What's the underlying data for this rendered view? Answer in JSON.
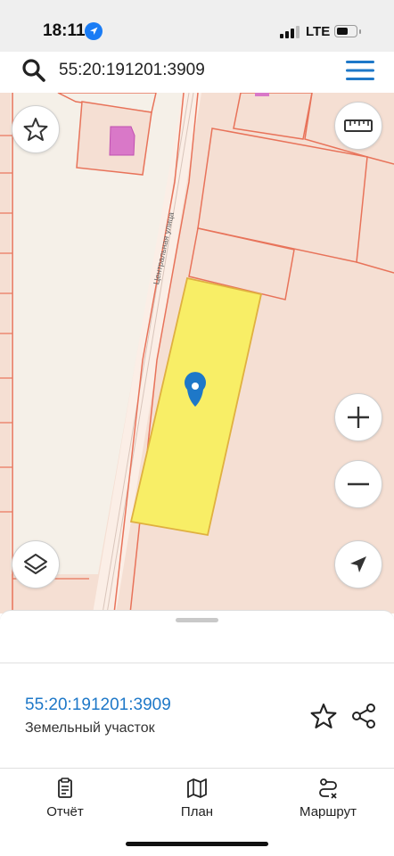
{
  "status_bar": {
    "time": "18:11",
    "network": "LTE",
    "battery_level": 0.6
  },
  "search": {
    "query": "55:20:191201:3909"
  },
  "map": {
    "street_label": "Центральная улица",
    "parcel_fill_color": "#f8ee66",
    "boundary_color": "#e8735a",
    "marker_color": "#1e78c8"
  },
  "details": {
    "cadastral_number": "55:20:191201:3909",
    "object_type": "Земельный участок"
  },
  "tabs": [
    {
      "label": "Отчёт",
      "icon": "report-icon"
    },
    {
      "label": "План",
      "icon": "map-plan-icon"
    },
    {
      "label": "Маршрут",
      "icon": "route-icon"
    }
  ]
}
